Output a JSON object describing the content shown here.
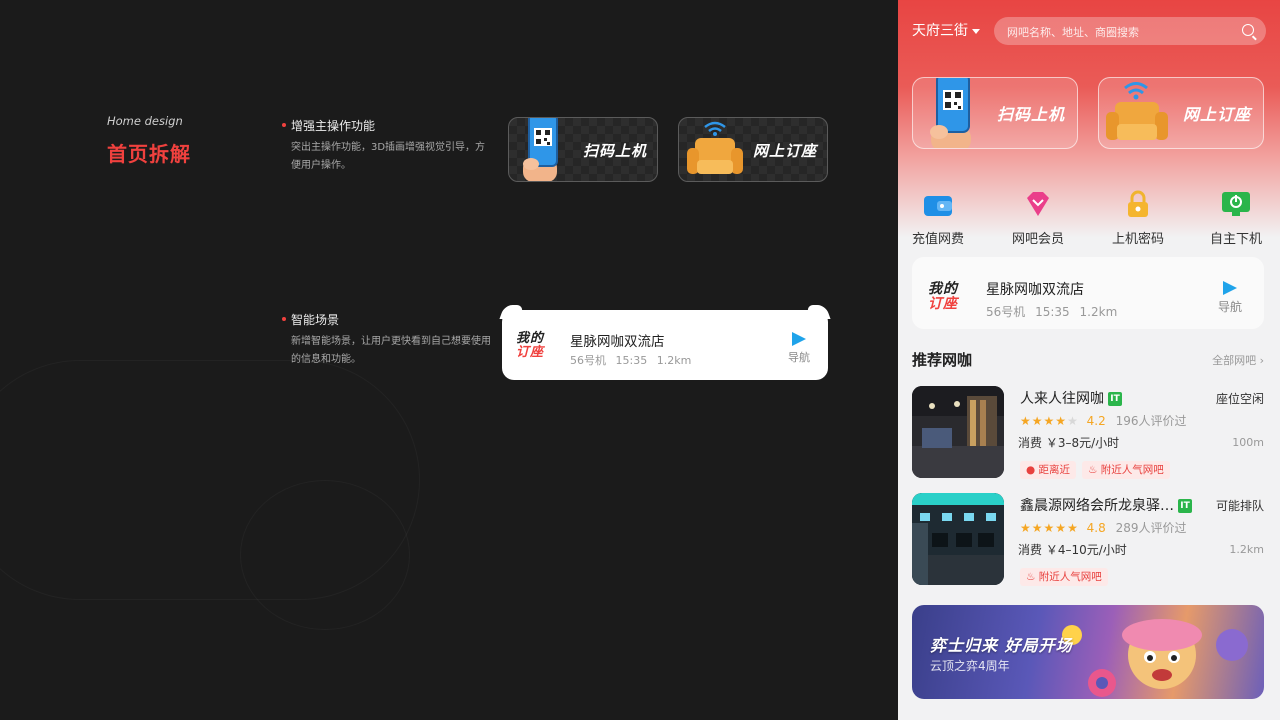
{
  "intro": {
    "subtitle_en": "Home design",
    "title_cn": "首页拆解"
  },
  "features": [
    {
      "title": "增强主操作功能",
      "desc": "突出主操作功能，3D插画增强视觉引导，方便用户操作。"
    },
    {
      "title": "智能场景",
      "desc": "新增智能场景，让用户更快看到自己想要使用的信息和功能。"
    }
  ],
  "main_actions": {
    "scan_label": "扫码上机",
    "order_label": "网上订座"
  },
  "my_order": {
    "badge_line1": "我的",
    "badge_line2": "订座",
    "store_name": "星脉网咖双流店",
    "seat": "56号机",
    "time": "15:35",
    "distance": "1.2km",
    "nav_label": "导航"
  },
  "phone": {
    "location": "天府三街",
    "search_placeholder": "网吧名称、地址、商圈搜索",
    "quick_actions": [
      {
        "label": "充值网费",
        "icon": "wallet-icon"
      },
      {
        "label": "网吧会员",
        "icon": "diamond-icon"
      },
      {
        "label": "上机密码",
        "icon": "lock-icon"
      },
      {
        "label": "自主下机",
        "icon": "power-monitor-icon"
      }
    ],
    "section_title": "推荐网咖",
    "section_more": "全部网吧",
    "cafes": [
      {
        "name": "人来人往网咖",
        "tag": "IT",
        "status": "座位空闲",
        "rating": 4.2,
        "score": "4.2",
        "reviews": "196人评价过",
        "price": "消费 ￥3–8元/小时",
        "distance": "100m",
        "chips": [
          "距离近",
          "附近人气网吧"
        ]
      },
      {
        "name": "鑫晨源网络会所龙泉驿…",
        "tag": "IT",
        "status": "可能排队",
        "rating": 4.8,
        "score": "4.8",
        "reviews": "289人评价过",
        "price": "消费 ￥4–10元/小时",
        "distance": "1.2km",
        "chips": [
          "附近人气网吧"
        ]
      }
    ],
    "banner": {
      "title": "弈士归来 好局开场",
      "subtitle": "云顶之弈4周年"
    }
  },
  "colors": {
    "accent": "#f0413e",
    "nav_blue": "#1fa3ea",
    "star": "#f5a623",
    "tag_green": "#2bb54b"
  }
}
